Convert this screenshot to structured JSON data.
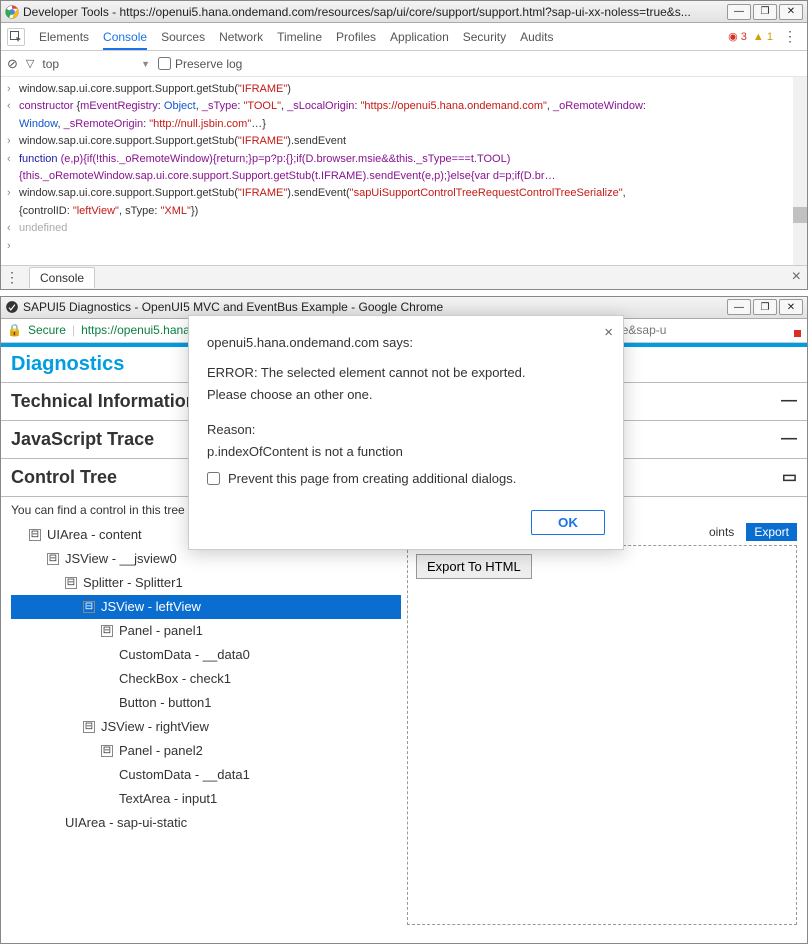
{
  "devtools": {
    "title": "Developer Tools - https://openui5.hana.ondemand.com/resources/sap/ui/core/support/support.html?sap-ui-xx-noless=true&s...",
    "tabs": [
      "Elements",
      "Console",
      "Sources",
      "Network",
      "Timeline",
      "Profiles",
      "Application",
      "Security",
      "Audits"
    ],
    "active_tab": 1,
    "errors": "3",
    "warnings": "1",
    "context": "top",
    "preserve_log_label": "Preserve log",
    "drawer_tab": "Console",
    "lines": [
      {
        "chev": "›",
        "parts": [
          {
            "t": "window.sap.ui.core.support.Support.getStub(",
            "c": ""
          },
          {
            "t": "\"IFRAME\"",
            "c": "str"
          },
          {
            "t": ")",
            "c": ""
          }
        ]
      },
      {
        "chev": "‹",
        "parts": [
          {
            "t": "constructor",
            "c": "pur"
          },
          {
            "t": " {",
            "c": ""
          },
          {
            "t": "mEventRegistry",
            "c": "pur"
          },
          {
            "t": ": ",
            "c": ""
          },
          {
            "t": "Object",
            "c": "blue"
          },
          {
            "t": ", ",
            "c": ""
          },
          {
            "t": "_sType",
            "c": "pur"
          },
          {
            "t": ": ",
            "c": ""
          },
          {
            "t": "\"TOOL\"",
            "c": "str"
          },
          {
            "t": ", ",
            "c": ""
          },
          {
            "t": "_sLocalOrigin",
            "c": "pur"
          },
          {
            "t": ": ",
            "c": ""
          },
          {
            "t": "\"https://openui5.hana.ondemand.com\"",
            "c": "str"
          },
          {
            "t": ", ",
            "c": ""
          },
          {
            "t": "_oRemoteWindow",
            "c": "pur"
          },
          {
            "t": ": ",
            "c": ""
          }
        ]
      },
      {
        "chev": " ",
        "parts": [
          {
            "t": "Window",
            "c": "blue"
          },
          {
            "t": ", ",
            "c": ""
          },
          {
            "t": "_sRemoteOrigin",
            "c": "pur"
          },
          {
            "t": ": ",
            "c": ""
          },
          {
            "t": "\"http://null.jsbin.com\"",
            "c": "str"
          },
          {
            "t": "…}",
            "c": ""
          }
        ]
      },
      {
        "chev": "›",
        "parts": [
          {
            "t": "window.sap.ui.core.support.Support.getStub(",
            "c": ""
          },
          {
            "t": "\"IFRAME\"",
            "c": "str"
          },
          {
            "t": ").sendEvent",
            "c": ""
          }
        ]
      },
      {
        "chev": "‹",
        "parts": [
          {
            "t": "function ",
            "c": "kw"
          },
          {
            "t": "(e,p){if(!this._oRemoteWindow){return;}p=p?p:{};if(D.browser.msie&&this._sType===t.TOOL)",
            "c": "pur"
          }
        ]
      },
      {
        "chev": " ",
        "parts": [
          {
            "t": "{this._oRemoteWindow.sap.ui.core.support.Support.getStub(t.IFRAME).sendEvent(e,p);}else{var d=p;if(D.br…",
            "c": "pur"
          }
        ]
      },
      {
        "chev": "›",
        "parts": [
          {
            "t": "window.sap.ui.core.support.Support.getStub(",
            "c": ""
          },
          {
            "t": "\"IFRAME\"",
            "c": "str"
          },
          {
            "t": ").sendEvent(",
            "c": ""
          },
          {
            "t": "\"sapUiSupportControlTreeRequestControlTreeSerialize\"",
            "c": "str"
          },
          {
            "t": ",",
            "c": ""
          }
        ]
      },
      {
        "chev": " ",
        "parts": [
          {
            "t": "{controlID: ",
            "c": ""
          },
          {
            "t": "\"leftView\"",
            "c": "str"
          },
          {
            "t": ", sType: ",
            "c": ""
          },
          {
            "t": "\"XML\"",
            "c": "str"
          },
          {
            "t": "})",
            "c": ""
          }
        ]
      },
      {
        "chev": "‹",
        "parts": [
          {
            "t": "undefined",
            "c": "undef"
          }
        ]
      },
      {
        "chev": "›",
        "parts": [
          {
            "t": "",
            "c": ""
          }
        ]
      }
    ]
  },
  "diag": {
    "title": "SAPUI5 Diagnostics - OpenUI5 MVC and EventBus Example - Google Chrome",
    "secure_label": "Secure",
    "url_origin": "https://openui5.hana.ondemand.com",
    "url_rest": "/resources/sap/ui/core/support/support.html?sap-ui-xx-noless=true&sap-u",
    "heading": "Diagnostics",
    "tech_info": "Technical Information",
    "js_trace": "JavaScript Trace",
    "control_tree": "Control Tree",
    "subtext": "You can find a control in this tree",
    "right_tabs_inactive": "oints",
    "right_tabs_active": "Export",
    "export_button": "Export To HTML",
    "tree": [
      {
        "level": 1,
        "exp": "⊟",
        "label": "UIArea - content"
      },
      {
        "level": 2,
        "exp": "⊟",
        "label": "JSView - __jsview0"
      },
      {
        "level": 3,
        "exp": "⊟",
        "label": "Splitter - Splitter1"
      },
      {
        "level": 4,
        "exp": "⊟",
        "label": "JSView - leftView",
        "selected": true
      },
      {
        "level": 5,
        "exp": "⊟",
        "label": "Panel - panel1"
      },
      {
        "level": 5,
        "exp": "",
        "label": "CustomData - __data0"
      },
      {
        "level": 5,
        "exp": "",
        "label": "CheckBox - check1"
      },
      {
        "level": 5,
        "exp": "",
        "label": "Button - button1"
      },
      {
        "level": 4,
        "exp": "⊟",
        "label": "JSView - rightView"
      },
      {
        "level": 5,
        "exp": "⊟",
        "label": "Panel - panel2"
      },
      {
        "level": 5,
        "exp": "",
        "label": "CustomData - __data1"
      },
      {
        "level": 5,
        "exp": "",
        "label": "TextArea - input1"
      },
      {
        "level": 2,
        "exp": "",
        "label": "UIArea - sap-ui-static"
      }
    ]
  },
  "modal": {
    "title": "openui5.hana.ondemand.com says:",
    "line1": "ERROR: The selected element cannot not be exported.",
    "line2": "Please choose an other one.",
    "reason_label": "Reason:",
    "reason": "p.indexOfContent is not a function",
    "prevent_label": "Prevent this page from creating additional dialogs.",
    "ok": "OK"
  },
  "winbuttons": {
    "min": "—",
    "max": "❐",
    "close": "✕"
  }
}
